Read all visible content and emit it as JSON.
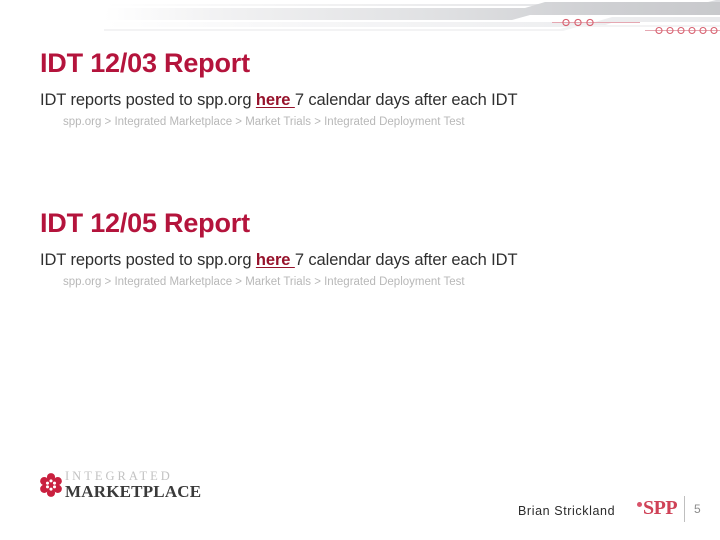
{
  "slide": {
    "page_number": "5",
    "presenter": "Brian Strickland",
    "accent_color": "#b4143c",
    "link_color": "#96122b",
    "spp_color": "#cf4257",
    "body_color": "#2f2f2f",
    "breadcrumb_color": "#b8b8b8"
  },
  "sections": [
    {
      "title": "IDT 12/03 Report",
      "body_before": "IDT reports posted to spp.org ",
      "body_link": "here ",
      "body_after": "7 calendar days after each IDT",
      "breadcrumb": "spp.org > Integrated Marketplace > Market Trials >  Integrated Deployment Test"
    },
    {
      "title": "IDT 12/05 Report",
      "body_before": "IDT reports posted to spp.org ",
      "body_link": "here ",
      "body_after": "7 calendar days after each IDT",
      "breadcrumb": "spp.org > Integrated Marketplace > Market Trials >  Integrated Deployment Test"
    }
  ],
  "footer": {
    "logo_integrated": "INTEGRATED",
    "logo_marketplace": "MARKETPLACE",
    "spp_label": "SPP"
  }
}
